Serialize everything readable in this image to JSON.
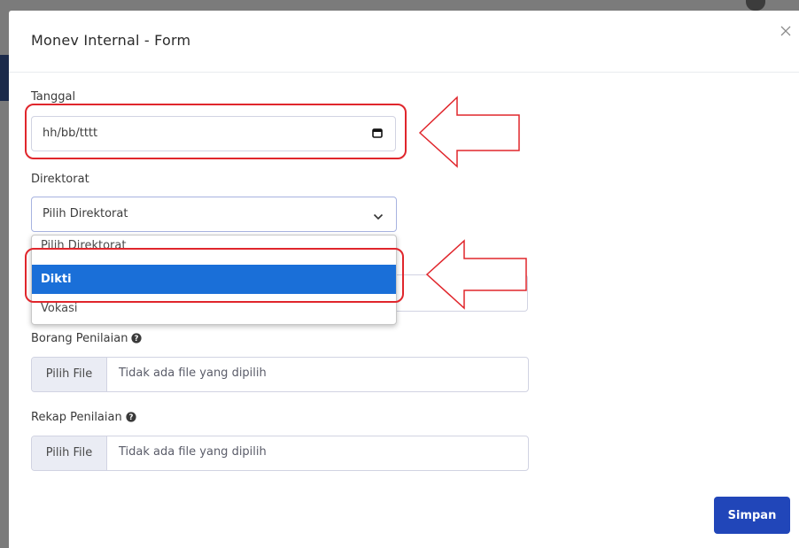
{
  "modal": {
    "title": "Monev Internal - Form",
    "close_icon": "close-icon"
  },
  "fields": {
    "tanggal": {
      "label": "Tanggal",
      "value": "hh/bb/tttt",
      "icon": "calendar-icon"
    },
    "direktorat": {
      "label": "Direktorat",
      "selected": "Pilih Direktorat",
      "options": [
        "Pilih Direktorat",
        "Dikti",
        "Vokasi"
      ],
      "highlighted_option": "Dikti"
    },
    "borang": {
      "label": "Borang Penilaian",
      "button": "Pilih File",
      "placeholder": "Tidak ada file yang dipilih",
      "icon": "question-circle-icon"
    },
    "rekap": {
      "label": "Rekap Penilaian",
      "button": "Pilih File",
      "placeholder": "Tidak ada file yang dipilih",
      "icon": "question-circle-icon"
    }
  },
  "footer": {
    "save_label": "Simpan"
  },
  "colors": {
    "primary": "#2146b9",
    "option_highlight": "#1a6fd8",
    "annotation": "#e0262c"
  }
}
